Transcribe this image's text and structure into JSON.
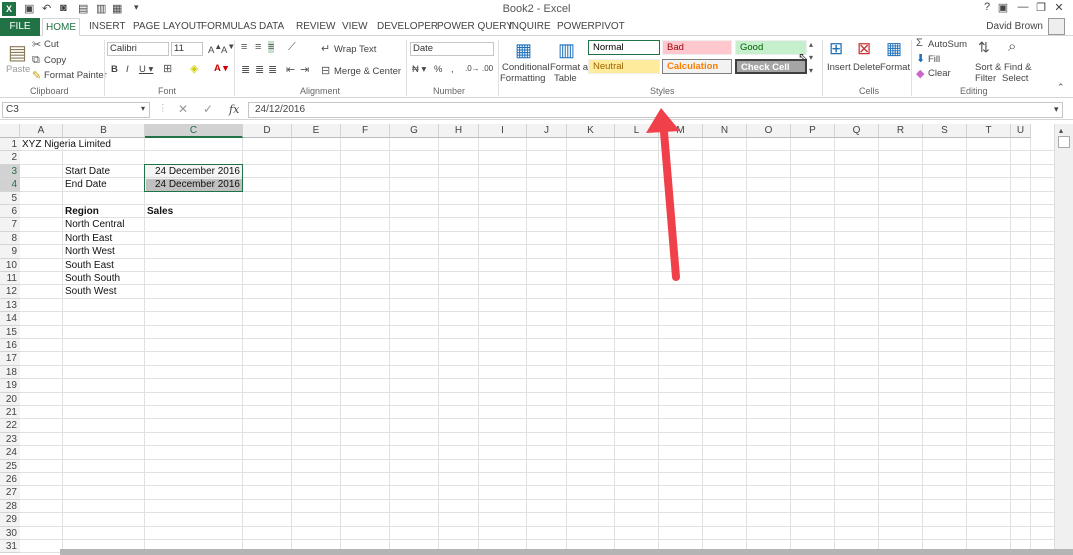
{
  "title": "Book2 - Excel",
  "user": "David Brown",
  "tabs": [
    "FILE",
    "HOME",
    "INSERT",
    "PAGE LAYOUT",
    "FORMULAS",
    "DATA",
    "REVIEW",
    "VIEW",
    "DEVELOPER",
    "POWER QUERY",
    "INQUIRE",
    "POWERPIVOT"
  ],
  "ribbon": {
    "clipboard": {
      "paste": "Paste",
      "cut": "Cut",
      "copy": "Copy",
      "format_painter": "Format Painter",
      "label": "Clipboard"
    },
    "font": {
      "name": "Calibri",
      "size": "11",
      "label": "Font"
    },
    "alignment": {
      "wrap": "Wrap Text",
      "merge": "Merge & Center",
      "label": "Alignment"
    },
    "number": {
      "format": "Date",
      "label": "Number"
    },
    "styles": {
      "conditional": "Conditional",
      "formatting": "Formatting",
      "format_as": "Format as",
      "table": "Table",
      "label": "Styles",
      "normal": "Normal",
      "bad": "Bad",
      "good": "Good",
      "neutral": "Neutral",
      "calculation": "Calculation",
      "check_cell": "Check Cell"
    },
    "cells": {
      "insert": "Insert",
      "delete": "Delete",
      "format": "Format",
      "label": "Cells"
    },
    "editing": {
      "autosum": "AutoSum",
      "fill": "Fill",
      "clear": "Clear",
      "sort": "Sort &",
      "filter": "Filter",
      "find": "Find &",
      "select": "Select",
      "label": "Editing"
    }
  },
  "formula_bar": {
    "name_box": "C3",
    "fx": "fx",
    "formula": "24/12/2016"
  },
  "columns": [
    "A",
    "B",
    "C",
    "D",
    "E",
    "F",
    "G",
    "H",
    "I",
    "J",
    "K",
    "L",
    "M",
    "N",
    "O",
    "P",
    "Q",
    "R",
    "S",
    "T",
    "U"
  ],
  "rows": [
    "1",
    "2",
    "3",
    "4",
    "5",
    "6",
    "7",
    "8",
    "9",
    "10",
    "11",
    "12",
    "13",
    "14",
    "15",
    "16",
    "17",
    "18",
    "19",
    "20",
    "21",
    "22",
    "23",
    "24",
    "25",
    "26",
    "27",
    "28",
    "29",
    "30",
    "31"
  ],
  "cells": {
    "A1": "XYZ Nigeria Limited",
    "B3": "Start Date",
    "C3": "24 December 2016",
    "B4": "End Date",
    "C4": "24 December 2016",
    "B6": "Region",
    "C6": "Sales",
    "B7": "North Central",
    "B8": "North East",
    "B9": "North West",
    "B10": "South East",
    "B11": "South South",
    "B12": "South West"
  },
  "colors": {
    "excel_green": "#217346",
    "arrow": "#f0404a",
    "bad_bg": "#ffc7ce",
    "good_bg": "#c6efce",
    "neutral_bg": "#ffeb9c",
    "calc_bg": "#f2f2f2",
    "check_bg": "#a5a5a5"
  }
}
